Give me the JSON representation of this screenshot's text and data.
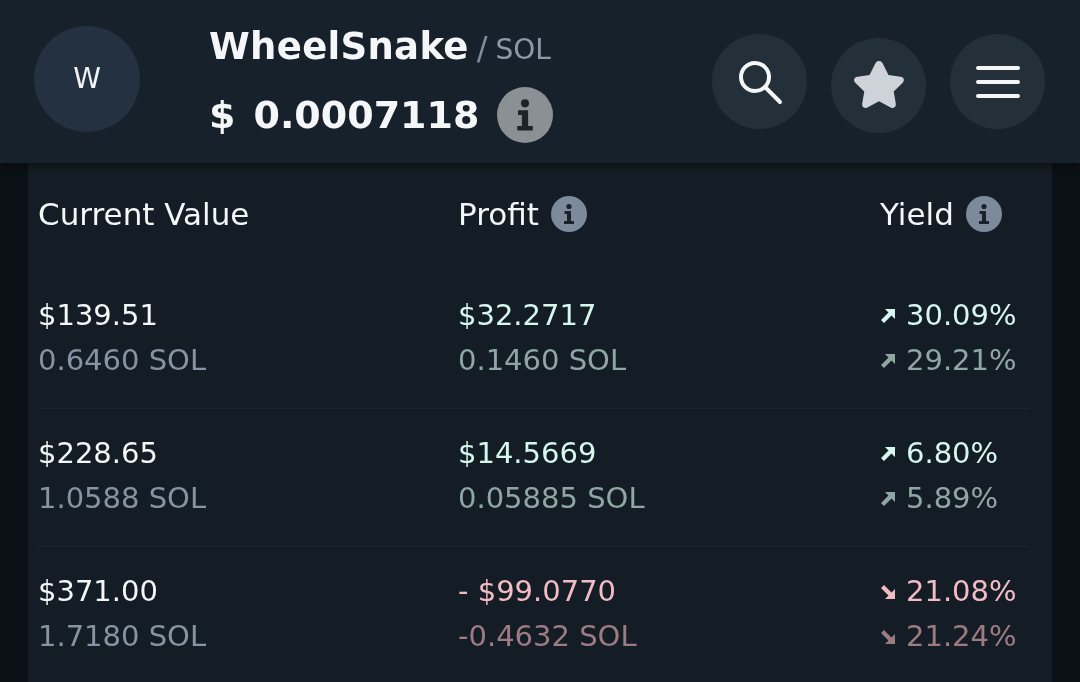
{
  "header": {
    "avatar_letter": "W",
    "name": "WheelSnake",
    "separator": "/",
    "quote": "SOL",
    "currency": "$",
    "price": "0.0007118"
  },
  "table": {
    "columns": [
      {
        "label": "Current Value",
        "info": false
      },
      {
        "label": "Profit",
        "info": true
      },
      {
        "label": "Yield",
        "info": true
      }
    ],
    "rows": [
      {
        "negative": false,
        "value_usd": "$139.51",
        "value_sol": "0.6460 SOL",
        "profit_usd": "$32.2717",
        "profit_sol": "0.1460 SOL",
        "yield_usd": "30.09%",
        "yield_sol": "29.21%"
      },
      {
        "negative": false,
        "value_usd": "$228.65",
        "value_sol": "1.0588 SOL",
        "profit_usd": "$14.5669",
        "profit_sol": "0.05885 SOL",
        "yield_usd": "6.80%",
        "yield_sol": "5.89%"
      },
      {
        "negative": true,
        "value_usd": "$371.00",
        "value_sol": "1.7180 SOL",
        "profit_usd": "- $99.0770",
        "profit_sol": "-0.4632 SOL",
        "yield_usd": "21.08%",
        "yield_sol": "21.24%"
      }
    ]
  }
}
